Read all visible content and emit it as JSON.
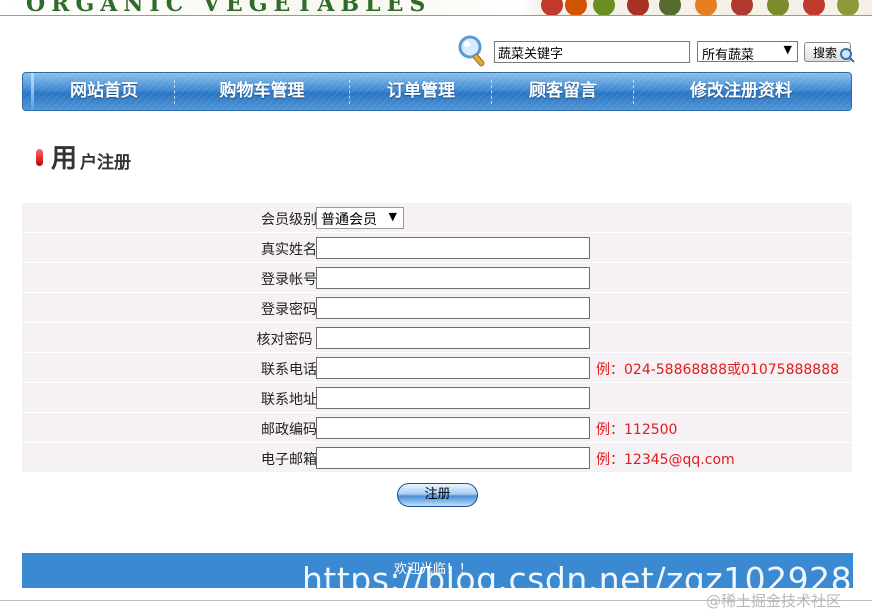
{
  "banner": {
    "text": "ORGANIC VEGETABLES"
  },
  "search": {
    "keyword_value": "蔬菜关键字",
    "category_selected": "所有蔬菜",
    "button_label": "搜索"
  },
  "nav": {
    "items": [
      {
        "label": "网站首页"
      },
      {
        "label": "购物车管理"
      },
      {
        "label": "订单管理"
      },
      {
        "label": "顾客留言"
      },
      {
        "label": "修改注册资料"
      }
    ]
  },
  "page_title": {
    "first_char": "用",
    "rest": "户注册"
  },
  "form": {
    "rows": [
      {
        "label": "会员级别：",
        "type": "select",
        "value": "普通会员"
      },
      {
        "label": "真实姓名：",
        "type": "input",
        "value": "",
        "hint": ""
      },
      {
        "label": "登录帐号：",
        "type": "input",
        "value": "",
        "hint": ""
      },
      {
        "label": "登录密码：",
        "type": "input",
        "value": "",
        "hint": ""
      },
      {
        "label": "核对密码 ：",
        "type": "input",
        "value": "",
        "hint": ""
      },
      {
        "label": "联系电话：",
        "type": "input",
        "value": "",
        "hint": "例：024-58868888或01075888888"
      },
      {
        "label": "联系地址：",
        "type": "input",
        "value": "",
        "hint": ""
      },
      {
        "label": "邮政编码：",
        "type": "input",
        "value": "",
        "hint": "例：112500"
      },
      {
        "label": "电子邮箱：",
        "type": "input",
        "value": "",
        "hint": "例：12345@qq.com"
      }
    ],
    "submit_label": "注册"
  },
  "footer": {
    "text": "欢迎光临！！"
  },
  "watermarks": {
    "url": "https://blog.csdn.net/zqz102928",
    "site": "@稀土掘金技术社区"
  },
  "colors": {
    "nav_blue": "#3f8ad2",
    "footer_blue": "#3b8ad1",
    "row_bg": "#f6f1f4",
    "hint_red": "#e21b1b",
    "title_bullet_red": "#c40000"
  },
  "icons": {
    "search": "magnifier-icon",
    "select_arrow": "dropdown-arrow-icon"
  }
}
